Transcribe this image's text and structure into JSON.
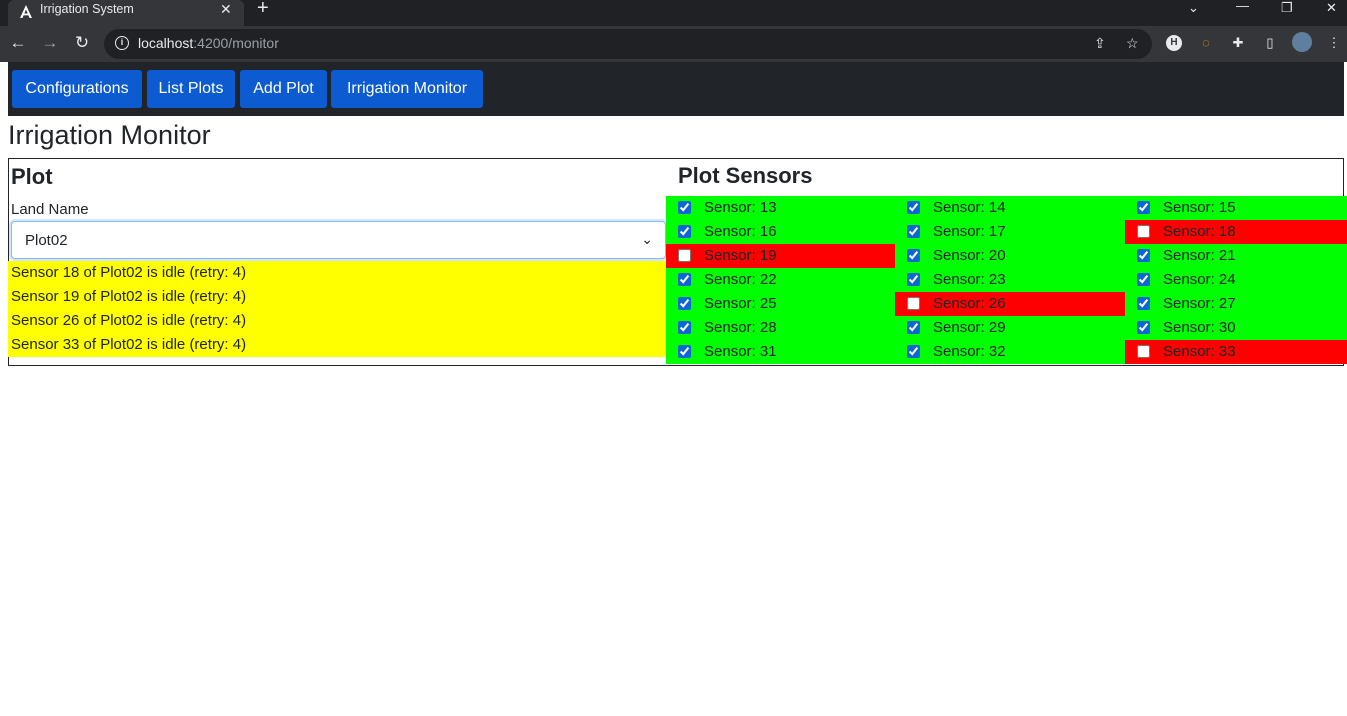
{
  "browser": {
    "tab_title": "Irrigation System",
    "tab_close": "✕",
    "new_tab": "+",
    "url_host": "localhost",
    "url_rest": ":4200/monitor",
    "window_controls": [
      "⌄",
      "—",
      "❐",
      "✕"
    ]
  },
  "navbar": {
    "buttons": [
      "Configurations",
      "List Plots",
      "Add Plot",
      "Irrigation Monitor"
    ]
  },
  "page": {
    "title": "Irrigation Monitor"
  },
  "plot": {
    "heading": "Plot",
    "land_label": "Land Name",
    "land_value": "Plot02"
  },
  "alerts": [
    "Sensor 18 of Plot02 is idle (retry: 4)",
    "Sensor 19 of Plot02 is idle (retry: 4)",
    "Sensor 26 of Plot02 is idle (retry: 4)",
    "Sensor 33 of Plot02 is idle (retry: 4)"
  ],
  "sensors": {
    "heading": "Plot Sensors",
    "items": [
      {
        "label": "Sensor: 13",
        "active": true
      },
      {
        "label": "Sensor: 14",
        "active": true
      },
      {
        "label": "Sensor: 15",
        "active": true
      },
      {
        "label": "Sensor: 16",
        "active": true
      },
      {
        "label": "Sensor: 17",
        "active": true
      },
      {
        "label": "Sensor: 18",
        "active": false
      },
      {
        "label": "Sensor: 19",
        "active": false
      },
      {
        "label": "Sensor: 20",
        "active": true
      },
      {
        "label": "Sensor: 21",
        "active": true
      },
      {
        "label": "Sensor: 22",
        "active": true
      },
      {
        "label": "Sensor: 23",
        "active": true
      },
      {
        "label": "Sensor: 24",
        "active": true
      },
      {
        "label": "Sensor: 25",
        "active": true
      },
      {
        "label": "Sensor: 26",
        "active": false
      },
      {
        "label": "Sensor: 27",
        "active": true
      },
      {
        "label": "Sensor: 28",
        "active": true
      },
      {
        "label": "Sensor: 29",
        "active": true
      },
      {
        "label": "Sensor: 30",
        "active": true
      },
      {
        "label": "Sensor: 31",
        "active": true
      },
      {
        "label": "Sensor: 32",
        "active": true
      },
      {
        "label": "Sensor: 33",
        "active": false
      }
    ]
  },
  "colors": {
    "sensor_active": "#00ff00",
    "sensor_idle": "#ff0000",
    "alert_background": "#ffff00",
    "nav_button": "#0d5bd1",
    "navbar_background": "#212529"
  }
}
